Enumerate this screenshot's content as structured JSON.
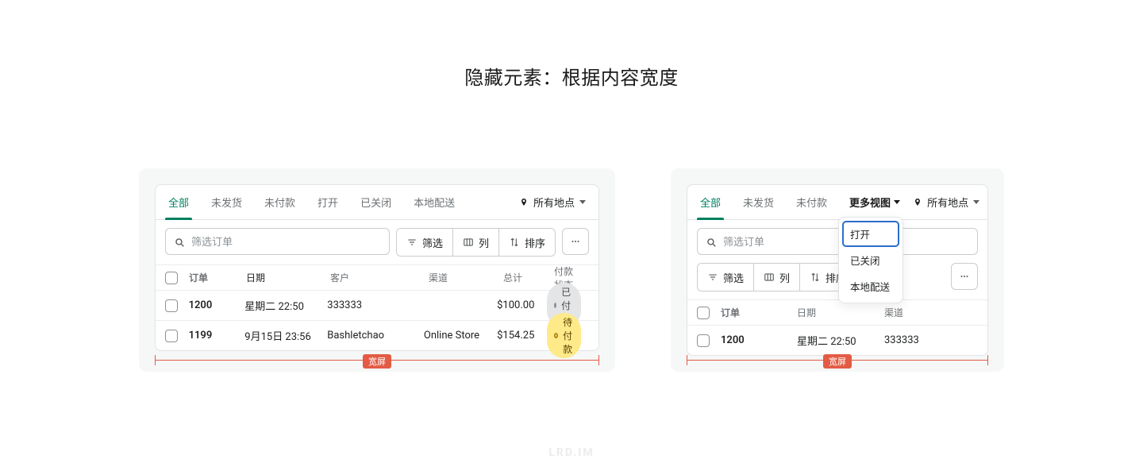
{
  "title": "隐藏元素：根据内容宽度",
  "annotation_label": "宽屏",
  "watermark": "LRD.IM",
  "search_placeholder": "筛选订单",
  "buttons": {
    "filter": "筛选",
    "columns": "列",
    "sort": "排序"
  },
  "location_label": "所有地点",
  "left": {
    "tabs": [
      "全部",
      "未发货",
      "未付款",
      "打开",
      "已关闭",
      "本地配送"
    ],
    "active_tab_index": 0,
    "columns": [
      "订单",
      "日期",
      "客户",
      "渠道",
      "总计",
      "付款状态"
    ],
    "rows": [
      {
        "order": "1200",
        "date": "星期二 22:50",
        "customer": "333333",
        "channel": "",
        "total": "$100.00",
        "status": "已付款",
        "status_kind": "gray"
      },
      {
        "order": "1199",
        "date": "9月15日 23:56",
        "customer": "Bashletchao",
        "channel": "Online Store",
        "total": "$154.25",
        "status": "待付款",
        "status_kind": "orange"
      }
    ]
  },
  "right": {
    "tabs": [
      "全部",
      "未发货",
      "未付款"
    ],
    "active_tab_index": 0,
    "more_tab_label": "更多视图",
    "more_menu": [
      "打开",
      "已关闭",
      "本地配送"
    ],
    "more_menu_selected_index": 0,
    "columns": [
      "订单",
      "日期",
      "",
      "渠道"
    ],
    "rows": [
      {
        "order": "1200",
        "date": "星期二 22:50",
        "customer": "333333"
      }
    ]
  }
}
